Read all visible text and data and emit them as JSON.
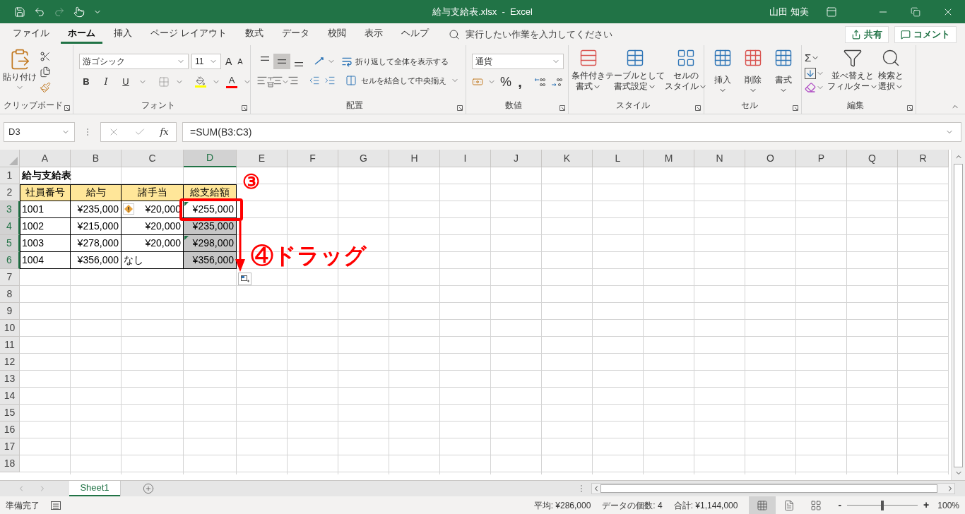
{
  "title_bar": {
    "title": "給与支給表.xlsx  -  Excel",
    "user": "山田 知美"
  },
  "menu_tabs": [
    {
      "label": "ファイル",
      "selected": false
    },
    {
      "label": "ホーム",
      "selected": true
    },
    {
      "label": "挿入",
      "selected": false
    },
    {
      "label": "ページ レイアウト",
      "selected": false
    },
    {
      "label": "数式",
      "selected": false
    },
    {
      "label": "データ",
      "selected": false
    },
    {
      "label": "校閲",
      "selected": false
    },
    {
      "label": "表示",
      "selected": false
    },
    {
      "label": "ヘルプ",
      "selected": false
    }
  ],
  "tell_me": {
    "placeholder": "実行したい作業を入力してください"
  },
  "share_button": "共有",
  "comment_button": "コメント",
  "ribbon": {
    "clipboard": {
      "label": "クリップボード",
      "paste": "貼り付け"
    },
    "font": {
      "label": "フォント",
      "name": "游ゴシック",
      "size": "11",
      "grow": "A",
      "shrink": "A",
      "bold": "B",
      "italic": "I",
      "underline": "U",
      "color_letter": "A"
    },
    "alignment": {
      "label": "配置",
      "vertical": [
        {
          "selected": false
        },
        {
          "selected": true
        },
        {
          "selected": false
        }
      ],
      "wrap": "折り返して全体を表示する",
      "merge": "セルを結合して中央揃え"
    },
    "number": {
      "label": "数値",
      "format": "通貨",
      "percent": "%",
      "comma": ","
    },
    "styles": {
      "label": "スタイル",
      "buttons": [
        {
          "kind": "conditional",
          "lines": [
            "条件付き",
            "書式"
          ]
        },
        {
          "kind": "table",
          "lines": [
            "テーブルとして",
            "書式設定"
          ]
        },
        {
          "kind": "cell_style",
          "lines": [
            "セルの",
            "スタイル"
          ]
        }
      ]
    },
    "cells": {
      "label": "セル",
      "buttons": [
        {
          "kind": "insert",
          "text": "挿入"
        },
        {
          "kind": "delete",
          "text": "削除"
        },
        {
          "kind": "format",
          "text": "書式"
        }
      ]
    },
    "editing": {
      "label": "編集",
      "sigma": "Σ",
      "buttons": [
        {
          "kind": "sort",
          "lines": [
            "並べ替えと",
            "フィルター"
          ]
        },
        {
          "kind": "find",
          "lines": [
            "検索と",
            "選択"
          ]
        }
      ]
    }
  },
  "formula_bar": {
    "name_box": "D3",
    "fx": "fx",
    "formula": "=SUM(B3:C3)"
  },
  "sheet": {
    "columns": [
      {
        "label": "A",
        "selected": false
      },
      {
        "label": "B",
        "selected": false
      },
      {
        "label": "C",
        "selected": false
      },
      {
        "label": "D",
        "selected": true
      },
      {
        "label": "E",
        "selected": false
      },
      {
        "label": "F",
        "selected": false
      },
      {
        "label": "G",
        "selected": false
      },
      {
        "label": "H",
        "selected": false
      },
      {
        "label": "I",
        "selected": false
      },
      {
        "label": "J",
        "selected": false
      },
      {
        "label": "K",
        "selected": false
      },
      {
        "label": "L",
        "selected": false
      },
      {
        "label": "M",
        "selected": false
      },
      {
        "label": "N",
        "selected": false
      },
      {
        "label": "O",
        "selected": false
      },
      {
        "label": "P",
        "selected": false
      },
      {
        "label": "Q",
        "selected": false
      },
      {
        "label": "R",
        "selected": false
      }
    ],
    "rows": [
      {
        "label": "1",
        "selected": false,
        "cells": [
          {
            "kind": "title",
            "text": "給与支給表"
          }
        ]
      },
      {
        "label": "2",
        "selected": false,
        "cells": [
          {
            "kind": "header",
            "text": "社員番号"
          },
          {
            "kind": "header",
            "text": "給与"
          },
          {
            "kind": "header",
            "text": "諸手当"
          },
          {
            "kind": "header",
            "text": "総支給額"
          }
        ]
      },
      {
        "label": "3",
        "selected": true,
        "cells": [
          {
            "kind": "text",
            "text": "1001"
          },
          {
            "kind": "number",
            "text": "¥235,000"
          },
          {
            "kind": "number",
            "text": "¥20,000",
            "warning": true
          },
          {
            "kind": "number",
            "text": "¥255,000",
            "highlighted": false,
            "error_flag": true
          }
        ]
      },
      {
        "label": "4",
        "selected": true,
        "cells": [
          {
            "kind": "text",
            "text": "1002"
          },
          {
            "kind": "number",
            "text": "¥215,000"
          },
          {
            "kind": "number",
            "text": "¥20,000",
            "warning": false
          },
          {
            "kind": "number",
            "text": "¥235,000",
            "highlighted": true,
            "error_flag": false
          }
        ]
      },
      {
        "label": "5",
        "selected": true,
        "cells": [
          {
            "kind": "text",
            "text": "1003"
          },
          {
            "kind": "number",
            "text": "¥278,000"
          },
          {
            "kind": "number",
            "text": "¥20,000",
            "warning": false
          },
          {
            "kind": "number",
            "text": "¥298,000",
            "highlighted": true,
            "error_flag": true
          }
        ]
      },
      {
        "label": "6",
        "selected": true,
        "cells": [
          {
            "kind": "text",
            "text": "1004"
          },
          {
            "kind": "number",
            "text": "¥356,000"
          },
          {
            "kind": "text",
            "text": "なし",
            "warning": false
          },
          {
            "kind": "number",
            "text": "¥356,000",
            "highlighted": true,
            "error_flag": false
          }
        ]
      },
      {
        "label": "7",
        "selected": false
      },
      {
        "label": "8",
        "selected": false
      },
      {
        "label": "9",
        "selected": false
      },
      {
        "label": "10",
        "selected": false
      },
      {
        "label": "11",
        "selected": false
      },
      {
        "label": "12",
        "selected": false
      },
      {
        "label": "13",
        "selected": false
      },
      {
        "label": "14",
        "selected": false
      },
      {
        "label": "15",
        "selected": false
      },
      {
        "label": "16",
        "selected": false
      },
      {
        "label": "17",
        "selected": false
      },
      {
        "label": "18",
        "selected": false
      }
    ]
  },
  "annotations": [
    {
      "kind": "step",
      "text": "③"
    },
    {
      "kind": "drag",
      "text": "④ドラッグ"
    }
  ],
  "sheet_tabs": [
    {
      "label": "Sheet1",
      "selected": true
    }
  ],
  "status_bar": {
    "status": "準備完了",
    "summary": [
      "平均: ¥286,000",
      "データの個数: 4",
      "合計: ¥1,144,000"
    ],
    "views": [
      {
        "kind": "normal",
        "selected": true
      },
      {
        "kind": "page_layout",
        "selected": false
      },
      {
        "kind": "page_break",
        "selected": false
      }
    ],
    "zoom": {
      "minus": "-",
      "plus": "+",
      "level": 0.5,
      "reading": "100%"
    }
  }
}
